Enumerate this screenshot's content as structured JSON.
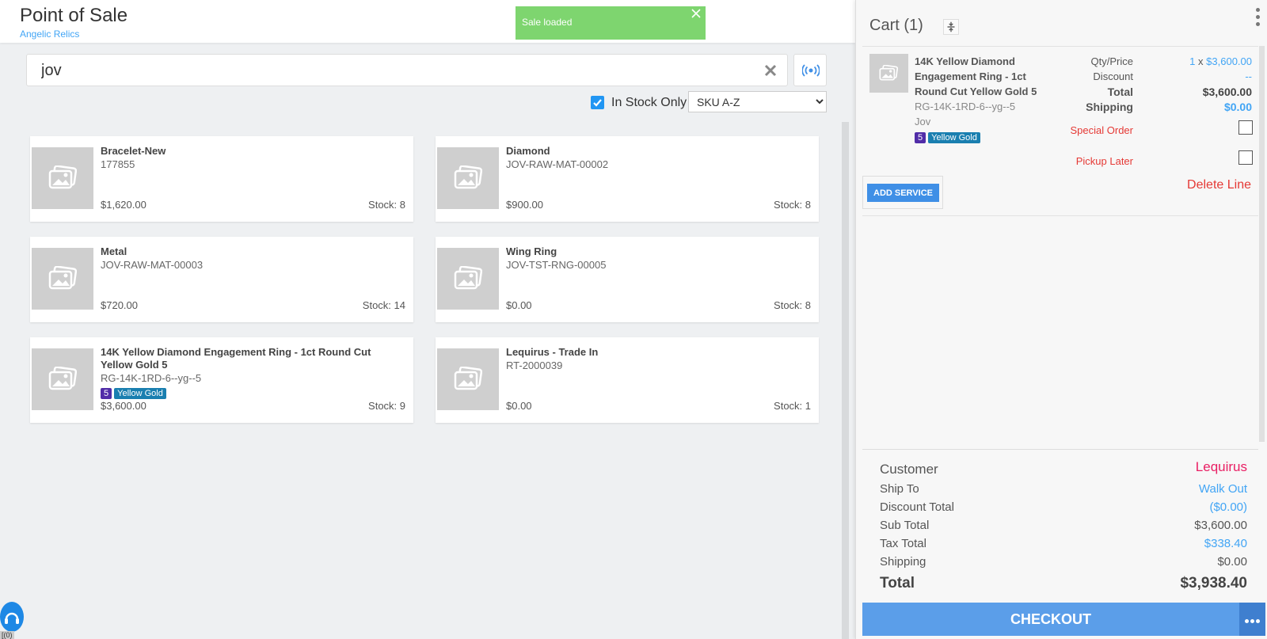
{
  "header": {
    "title": "Point of Sale",
    "subtitle": "Angelic Relics"
  },
  "toast": {
    "message": "Sale loaded"
  },
  "search": {
    "value": "jov"
  },
  "filter": {
    "in_stock_label": "In Stock Only",
    "in_stock_checked": true,
    "sort_selected": "SKU A-Z"
  },
  "products": [
    {
      "name": "Bracelet-New",
      "sku": "177855",
      "price": "$1,620.00",
      "stock": "Stock: 8"
    },
    {
      "name": "Diamond",
      "sku": "JOV-RAW-MAT-00002",
      "price": "$900.00",
      "stock": "Stock: 8"
    },
    {
      "name": "Metal",
      "sku": "JOV-RAW-MAT-00003",
      "price": "$720.00",
      "stock": "Stock: 14"
    },
    {
      "name": "Wing Ring",
      "sku": "JOV-TST-RNG-00005",
      "price": "$0.00",
      "stock": "Stock: 8"
    },
    {
      "name": "14K Yellow Diamond Engagement Ring - 1ct Round Cut Yellow Gold 5",
      "sku": "RG-14K-1RD-6--yg--5",
      "badge_num": "5",
      "badge_color": "Yellow Gold",
      "price": "$3,600.00",
      "stock": "Stock: 9"
    },
    {
      "name": "Lequirus - Trade In",
      "sku": "RT-2000039",
      "price": "$0.00",
      "stock": "Stock: 1"
    }
  ],
  "cart": {
    "title": "Cart (1)",
    "line": {
      "name": "14K Yellow Diamond Engagement Ring - 1ct Round Cut Yellow Gold 5",
      "sku": "RG-14K-1RD-6--yg--5",
      "vendor": "Jov",
      "badge_num": "5",
      "badge_color": "Yellow Gold",
      "qty_price_label": "Qty/Price",
      "qty": "1",
      "qty_sep": "x",
      "unit_price": "$3,600.00",
      "discount_label": "Discount",
      "discount_value": "--",
      "total_label": "Total",
      "total_value": "$3,600.00",
      "shipping_label": "Shipping",
      "shipping_value": "$0.00",
      "special_order_label": "Special Order",
      "pickup_later_label": "Pickup Later",
      "add_service_label": "ADD SERVICE",
      "delete_line_label": "Delete Line"
    },
    "summary": {
      "customer_label": "Customer",
      "customer_value": "Lequirus",
      "ship_to_label": "Ship To",
      "ship_to_value": "Walk Out",
      "discount_total_label": "Discount Total",
      "discount_total_value": "($0.00)",
      "sub_total_label": "Sub Total",
      "sub_total_value": "$3,600.00",
      "tax_total_label": "Tax Total",
      "tax_total_value": "$338.40",
      "shipping_label": "Shipping",
      "shipping_value": "$0.00",
      "total_label": "Total",
      "total_value": "$3,938.40"
    },
    "checkout_label": "CHECKOUT"
  },
  "help_tag": "[(0)"
}
